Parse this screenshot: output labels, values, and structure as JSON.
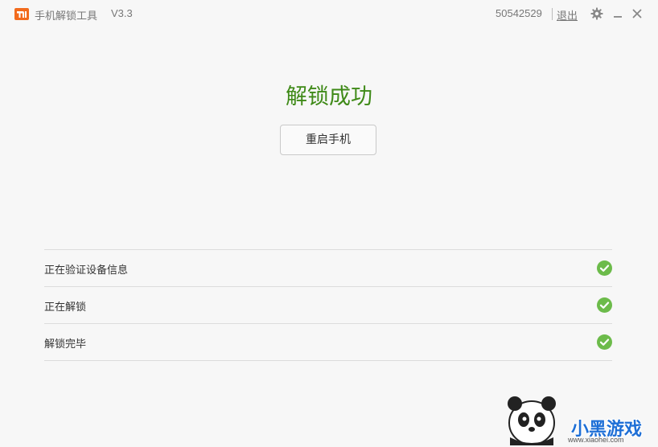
{
  "titlebar": {
    "logo_icon": "mi-logo-icon",
    "app_title": "手机解锁工具",
    "version": "V3.3",
    "user_id": "50542529",
    "logout_label": "退出",
    "icons": [
      "gear-icon",
      "minimize-icon",
      "close-icon"
    ]
  },
  "main": {
    "headline": "解锁成功",
    "restart_button": "重启手机"
  },
  "steps": [
    {
      "label": "正在验证设备信息",
      "status": "done",
      "icon": "check-circle-icon"
    },
    {
      "label": "正在解锁",
      "status": "done",
      "icon": "check-circle-icon"
    },
    {
      "label": "解锁完毕",
      "status": "done",
      "icon": "check-circle-icon"
    }
  ],
  "watermark": {
    "text": "小黑游戏",
    "url": "www.xiaohei.com"
  },
  "colors": {
    "accent_orange": "#f26b1d",
    "success_green": "#3f8a18",
    "check_green": "#6cbb4a",
    "background": "#f7f7f7"
  }
}
